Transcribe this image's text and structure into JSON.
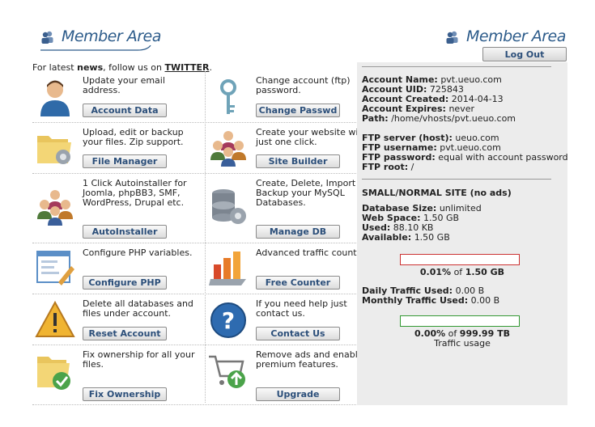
{
  "header": {
    "left_title": "Member Area",
    "right_title": "Member Area",
    "logout_label": "Log Out"
  },
  "news": {
    "prefix": "For latest ",
    "news_word": "news",
    "middle": ", follow us on ",
    "twitter": "TWITTER",
    "suffix": "."
  },
  "cells": [
    {
      "icon": "user-icon",
      "text": "Update your email address.",
      "button": "Account Data"
    },
    {
      "icon": "key-icon",
      "text": "Change account (ftp) password.",
      "button": "Change Passwd"
    },
    {
      "icon": "folder-gear-icon",
      "text": "Upload, edit or backup your files. Zip support.",
      "button": "File Manager"
    },
    {
      "icon": "people-icon",
      "text": "Create your website with just one click.",
      "button": "Site Builder"
    },
    {
      "icon": "group-icon",
      "text": "1 Click Autoinstaller for Joomla, phpBB3, SMF, WordPress, Drupal etc.",
      "button": "AutoInstaller"
    },
    {
      "icon": "database-gear-icon",
      "text": "Create, Delete, Import or Backup your MySQL Databases.",
      "button": "Manage DB"
    },
    {
      "icon": "php-config-icon",
      "text": "Configure PHP variables.",
      "button": "Configure PHP"
    },
    {
      "icon": "bar-chart-icon",
      "text": "Advanced traffic counter.",
      "button": "Free Counter"
    },
    {
      "icon": "warning-icon",
      "text": "Delete all databases and files under account.",
      "button": "Reset Account"
    },
    {
      "icon": "help-icon",
      "text": "If you need help just contact us.",
      "button": "Contact Us"
    },
    {
      "icon": "folder-check-icon",
      "text": "Fix ownership for all your files.",
      "button": "Fix Ownership"
    },
    {
      "icon": "cart-upgrade-icon",
      "text": "Remove ads and enable premium features.",
      "button": "Upgrade"
    }
  ],
  "account": {
    "name_label": "Account Name:",
    "name": "pvt.ueuo.com",
    "uid_label": "Account UID:",
    "uid": "725843",
    "created_label": "Account Created:",
    "created": "2014-04-13",
    "expires_label": "Account Expires:",
    "expires": "never",
    "path_label": "Path:",
    "path": "/home/vhosts/pvt.ueuo.com"
  },
  "ftp": {
    "server_label": "FTP server (host):",
    "server": "ueuo.com",
    "user_label": "FTP username:",
    "user": "pvt.ueuo.com",
    "pass_label": "FTP password:",
    "pass": "equal with account password",
    "root_label": "FTP root:",
    "root": "/"
  },
  "site": {
    "type": "SMALL/NORMAL SITE (no ads)",
    "db_label": "Database Size:",
    "db": "unlimited",
    "web_label": "Web Space:",
    "web": "1.50 GB",
    "used_label": "Used:",
    "used": "88.10 KB",
    "avail_label": "Available:",
    "avail": "1.50 GB",
    "disk_pct": "0.01%",
    "disk_of": " of ",
    "disk_total": "1.50 GB",
    "disk_fraction": 0.0001
  },
  "traffic": {
    "daily_label": "Daily Traffic Used:",
    "daily": "0.00 B",
    "monthly_label": "Monthly Traffic Used:",
    "monthly": "0.00 B",
    "pct": "0.00%",
    "of": " of ",
    "total": "999.99 TB",
    "caption": "Traffic usage",
    "fraction": 0
  },
  "colors": {
    "title": "#2c5b8a",
    "button_text": "#2c4f7a",
    "disk_bar": "#cc3333",
    "traffic_bar": "#339933",
    "panel_bg": "#ececec"
  }
}
